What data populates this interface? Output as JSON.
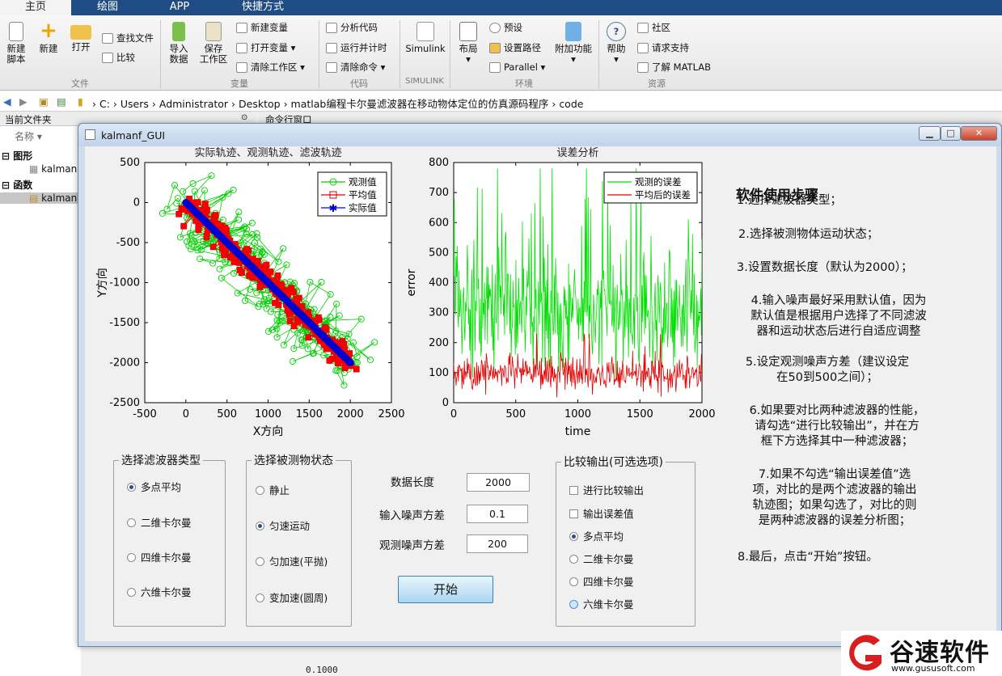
{
  "tabs": [
    "主页",
    "绘图",
    "APP",
    "快捷方式"
  ],
  "ribbon": {
    "file": {
      "new_script": "新建\n脚本",
      "new": "新建",
      "open": "打开",
      "find_files": "查找文件",
      "compare": "比较",
      "group": "文件"
    },
    "variable": {
      "import": "导入\n数据",
      "save": "保存\n工作区",
      "new_var": "新建变量",
      "open_var": "打开变量",
      "clear_ws": "清除工作区",
      "group": "变量"
    },
    "code": {
      "analyze": "分析代码",
      "run_time": "运行并计时",
      "clear_cmd": "清除命令",
      "group": "代码"
    },
    "simulink": {
      "label": "Simulink",
      "group": "SIMULINK"
    },
    "env": {
      "layout": "布局",
      "prefs": "预设",
      "set_path": "设置路径",
      "parallel": "Parallel",
      "addons": "附加功能",
      "group": "环境"
    },
    "resources": {
      "help": "帮助",
      "community": "社区",
      "request": "请求支持",
      "learn": "了解 MATLAB",
      "group": "资源"
    }
  },
  "address": [
    "C:",
    "Users",
    "Administrator",
    "Desktop",
    "matlab编程卡尔曼滤波器在移动物体定位的仿真源码程序",
    "code"
  ],
  "left_panel": {
    "header": "当前文件夹",
    "col_name": "名称",
    "group_fig": "图形",
    "group_func": "函数",
    "file1": "kalman",
    "file2": "kalman"
  },
  "command": {
    "header": "命令行窗口",
    "output": "0.1000"
  },
  "window": {
    "title": "kalmanf_GUI"
  },
  "chart_data": [
    {
      "type": "scatter",
      "title": "实际轨迹、观测轨迹、滤波轨迹",
      "xlabel": "X方向",
      "ylabel": "Y方向",
      "xlim": [
        -500,
        2500
      ],
      "ylim": [
        -2500,
        500
      ],
      "xticks": [
        -500,
        0,
        500,
        1000,
        1500,
        2000,
        2500
      ],
      "yticks": [
        500,
        0,
        -500,
        -1000,
        -1500,
        -2000,
        -2500
      ],
      "legend": [
        "观测值",
        "平均值",
        "实际值"
      ],
      "legend_position": "top-right",
      "series": [
        {
          "name": "观测值",
          "color": "#00d000",
          "noise": 280
        },
        {
          "name": "平均值",
          "color": "#e00000",
          "noise": 90
        },
        {
          "name": "实际值",
          "color": "#0000d0",
          "x": [
            0,
            2000
          ],
          "y": [
            0,
            -2000
          ]
        }
      ]
    },
    {
      "type": "line",
      "title": "误差分析",
      "xlabel": "time",
      "ylabel": "error",
      "xlim": [
        0,
        2000
      ],
      "ylim": [
        0,
        800
      ],
      "xticks": [
        0,
        500,
        1000,
        1500,
        2000
      ],
      "yticks": [
        800,
        700,
        600,
        500,
        400,
        300,
        200,
        100,
        0
      ],
      "legend": [
        "观测的误差",
        "平均后的误差"
      ],
      "legend_position": "top-right",
      "series": [
        {
          "name": "观测的误差",
          "color": "#00e000",
          "mean": 300,
          "max": 780
        },
        {
          "name": "平均后的误差",
          "color": "#e00000",
          "mean": 95,
          "max": 230
        }
      ]
    }
  ],
  "filter_panel": {
    "title": "选择滤波器类型",
    "options": [
      "多点平均",
      "二维卡尔曼",
      "四维卡尔曼",
      "六维卡尔曼"
    ],
    "selected": 0
  },
  "state_panel": {
    "title": "选择被测物状态",
    "options": [
      "静止",
      "匀速运动",
      "匀加速(平抛)",
      "变加速(圆周)"
    ],
    "selected": 1
  },
  "params": {
    "length_label": "数据长度",
    "length_value": "2000",
    "input_noise_label": "输入噪声方差",
    "input_noise_value": "0.1",
    "obs_noise_label": "观测噪声方差",
    "obs_noise_value": "200"
  },
  "start_label": "开始",
  "compare_panel": {
    "title": "比较输出(可选选项)",
    "checks": [
      "进行比较输出",
      "输出误差值"
    ],
    "options": [
      "多点平均",
      "二维卡尔曼",
      "四维卡尔曼",
      "六维卡尔曼"
    ],
    "selected": 0
  },
  "help": {
    "title": "软件使用步骤",
    "s1": "1.选择滤波器类型；",
    "s2": "2.选择被测物体运动状态；",
    "s3": "3.设置数据长度（默认为2000）；",
    "s4a": "4.输入噪声最好采用默认值，因为",
    "s4b": "默认值是根据用户选择了不同滤波",
    "s4c": "器和运动状态后进行自适应调整",
    "s5a": "5.设定观测噪声方差（建议设定",
    "s5b": "在50到500之间）；",
    "s6a": "6.如果要对比两种滤波器的性能，",
    "s6b": "请勾选“进行比较输出”，并在方",
    "s6c": "框下方选择其中一种滤波器；",
    "s7a": "7.如果不勾选“输出误差值”选",
    "s7b": "项，对比的是两个滤波器的输出",
    "s7c": "轨迹图；如果勾选了，对比的则",
    "s7d": "是两种滤波器的误差分析图；",
    "s8": "8.最后，点击“开始”按钮。"
  },
  "watermark": {
    "name": "谷速软件",
    "url": "www.gususoft.com"
  },
  "colors": {
    "tabbar": "#1f4c82",
    "accent": "#3c7fb1"
  }
}
